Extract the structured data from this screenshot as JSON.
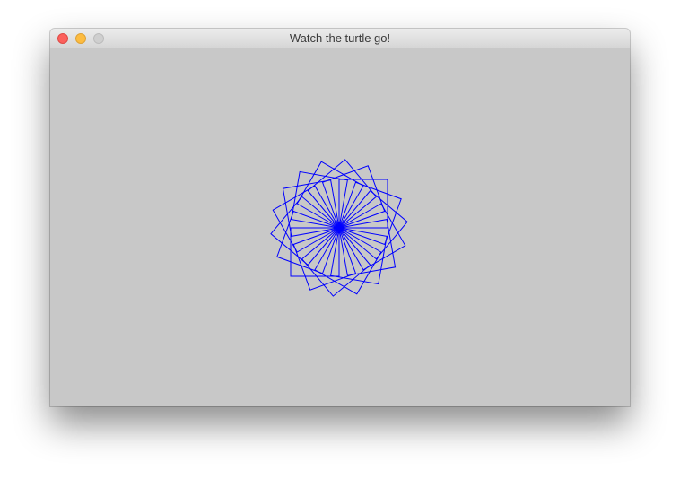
{
  "window": {
    "title": "Watch the turtle go!",
    "controls": {
      "close": "close-icon",
      "minimize": "minimize-icon",
      "zoom": "zoom-icon"
    }
  },
  "canvas": {
    "background_color": "#c8c8c8",
    "drawing": {
      "shape": "rotated-square-rosette",
      "squares": 18,
      "rotation_step_degrees": 20,
      "stroke_color": "#0000ff"
    }
  }
}
